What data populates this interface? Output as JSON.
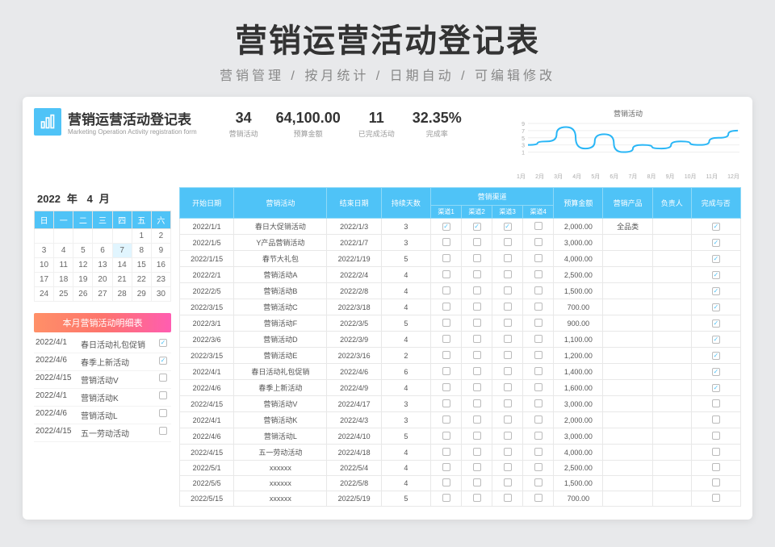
{
  "header": {
    "title": "营销运营活动登记表",
    "subtitle": "营销管理 / 按月统计 / 日期自动 / 可编辑修改"
  },
  "brand": {
    "title_cn": "营销运营活动登记表",
    "title_en": "Marketing Operation Activity registration form"
  },
  "kpis": [
    {
      "value": "34",
      "label": "营销活动"
    },
    {
      "value": "64,100.00",
      "label": "预算金额"
    },
    {
      "value": "11",
      "label": "已完成活动"
    },
    {
      "value": "32.35%",
      "label": "完成率"
    }
  ],
  "chart_data": {
    "type": "line",
    "title": "营销活动",
    "categories": [
      "1月",
      "2月",
      "3月",
      "4月",
      "5月",
      "6月",
      "7月",
      "8月",
      "9月",
      "10月",
      "11月",
      "12月"
    ],
    "values": [
      3,
      4,
      8,
      2,
      6,
      1,
      3,
      2,
      4,
      3,
      5,
      7
    ],
    "ylim": [
      0,
      9
    ],
    "ylabel": "",
    "xlabel": ""
  },
  "calendar": {
    "year": "2022",
    "year_suffix": "年",
    "month": "4",
    "month_suffix": "月",
    "dow": [
      "日",
      "一",
      "二",
      "三",
      "四",
      "五",
      "六"
    ],
    "weeks": [
      [
        "",
        "",
        "",
        "",
        "",
        "1",
        "2"
      ],
      [
        "3",
        "4",
        "5",
        "6",
        "7",
        "8",
        "9"
      ],
      [
        "10",
        "11",
        "12",
        "13",
        "14",
        "15",
        "16"
      ],
      [
        "17",
        "18",
        "19",
        "20",
        "21",
        "22",
        "23"
      ],
      [
        "24",
        "25",
        "26",
        "27",
        "28",
        "29",
        "30"
      ]
    ],
    "today": "7"
  },
  "summary_title": "本月营销活动明细表",
  "summary": [
    {
      "date": "2022/4/1",
      "name": "春日活动礼包促销",
      "done": true
    },
    {
      "date": "2022/4/6",
      "name": "春季上新活动",
      "done": true
    },
    {
      "date": "2022/4/15",
      "name": "营销活动V",
      "done": false
    },
    {
      "date": "2022/4/1",
      "name": "营销活动K",
      "done": false
    },
    {
      "date": "2022/4/6",
      "name": "营销活动L",
      "done": false
    },
    {
      "date": "2022/4/15",
      "name": "五一劳动活动",
      "done": false
    }
  ],
  "table": {
    "headers": {
      "start": "开始日期",
      "activity": "营销活动",
      "end": "结束日期",
      "days": "持续天数",
      "channels": "营销渠道",
      "ch1": "渠道1",
      "ch2": "渠道2",
      "ch3": "渠道3",
      "ch4": "渠道4",
      "budget": "预算金额",
      "product": "营销产品",
      "owner": "负责人",
      "done": "完成与否"
    },
    "rows": [
      {
        "start": "2022/1/1",
        "act": "春日大促销活动",
        "end": "2022/1/3",
        "days": "3",
        "c": [
          true,
          true,
          true,
          false
        ],
        "budget": "2,000.00",
        "product": "全品类",
        "owner": "",
        "done": true
      },
      {
        "start": "2022/1/5",
        "act": "Y产品营销活动",
        "end": "2022/1/7",
        "days": "3",
        "c": [
          false,
          false,
          false,
          false
        ],
        "budget": "3,000.00",
        "product": "",
        "owner": "",
        "done": true
      },
      {
        "start": "2022/1/15",
        "act": "春节大礼包",
        "end": "2022/1/19",
        "days": "5",
        "c": [
          false,
          false,
          false,
          false
        ],
        "budget": "4,000.00",
        "product": "",
        "owner": "",
        "done": true
      },
      {
        "start": "2022/2/1",
        "act": "营销活动A",
        "end": "2022/2/4",
        "days": "4",
        "c": [
          false,
          false,
          false,
          false
        ],
        "budget": "2,500.00",
        "product": "",
        "owner": "",
        "done": true
      },
      {
        "start": "2022/2/5",
        "act": "营销活动B",
        "end": "2022/2/8",
        "days": "4",
        "c": [
          false,
          false,
          false,
          false
        ],
        "budget": "1,500.00",
        "product": "",
        "owner": "",
        "done": true
      },
      {
        "start": "2022/3/15",
        "act": "营销活动C",
        "end": "2022/3/18",
        "days": "4",
        "c": [
          false,
          false,
          false,
          false
        ],
        "budget": "700.00",
        "product": "",
        "owner": "",
        "done": true
      },
      {
        "start": "2022/3/1",
        "act": "营销活动F",
        "end": "2022/3/5",
        "days": "5",
        "c": [
          false,
          false,
          false,
          false
        ],
        "budget": "900.00",
        "product": "",
        "owner": "",
        "done": true
      },
      {
        "start": "2022/3/6",
        "act": "营销活动D",
        "end": "2022/3/9",
        "days": "4",
        "c": [
          false,
          false,
          false,
          false
        ],
        "budget": "1,100.00",
        "product": "",
        "owner": "",
        "done": true
      },
      {
        "start": "2022/3/15",
        "act": "营销活动E",
        "end": "2022/3/16",
        "days": "2",
        "c": [
          false,
          false,
          false,
          false
        ],
        "budget": "1,200.00",
        "product": "",
        "owner": "",
        "done": true
      },
      {
        "start": "2022/4/1",
        "act": "春日活动礼包促销",
        "end": "2022/4/6",
        "days": "6",
        "c": [
          false,
          false,
          false,
          false
        ],
        "budget": "1,400.00",
        "product": "",
        "owner": "",
        "done": true
      },
      {
        "start": "2022/4/6",
        "act": "春季上新活动",
        "end": "2022/4/9",
        "days": "4",
        "c": [
          false,
          false,
          false,
          false
        ],
        "budget": "1,600.00",
        "product": "",
        "owner": "",
        "done": true
      },
      {
        "start": "2022/4/15",
        "act": "营销活动V",
        "end": "2022/4/17",
        "days": "3",
        "c": [
          false,
          false,
          false,
          false
        ],
        "budget": "3,000.00",
        "product": "",
        "owner": "",
        "done": false
      },
      {
        "start": "2022/4/1",
        "act": "营销活动K",
        "end": "2022/4/3",
        "days": "3",
        "c": [
          false,
          false,
          false,
          false
        ],
        "budget": "2,000.00",
        "product": "",
        "owner": "",
        "done": false
      },
      {
        "start": "2022/4/6",
        "act": "营销活动L",
        "end": "2022/4/10",
        "days": "5",
        "c": [
          false,
          false,
          false,
          false
        ],
        "budget": "3,000.00",
        "product": "",
        "owner": "",
        "done": false
      },
      {
        "start": "2022/4/15",
        "act": "五一劳动活动",
        "end": "2022/4/18",
        "days": "4",
        "c": [
          false,
          false,
          false,
          false
        ],
        "budget": "4,000.00",
        "product": "",
        "owner": "",
        "done": false
      },
      {
        "start": "2022/5/1",
        "act": "xxxxxx",
        "end": "2022/5/4",
        "days": "4",
        "c": [
          false,
          false,
          false,
          false
        ],
        "budget": "2,500.00",
        "product": "",
        "owner": "",
        "done": false
      },
      {
        "start": "2022/5/5",
        "act": "xxxxxx",
        "end": "2022/5/8",
        "days": "4",
        "c": [
          false,
          false,
          false,
          false
        ],
        "budget": "1,500.00",
        "product": "",
        "owner": "",
        "done": false
      },
      {
        "start": "2022/5/15",
        "act": "xxxxxx",
        "end": "2022/5/19",
        "days": "5",
        "c": [
          false,
          false,
          false,
          false
        ],
        "budget": "700.00",
        "product": "",
        "owner": "",
        "done": false
      }
    ]
  }
}
